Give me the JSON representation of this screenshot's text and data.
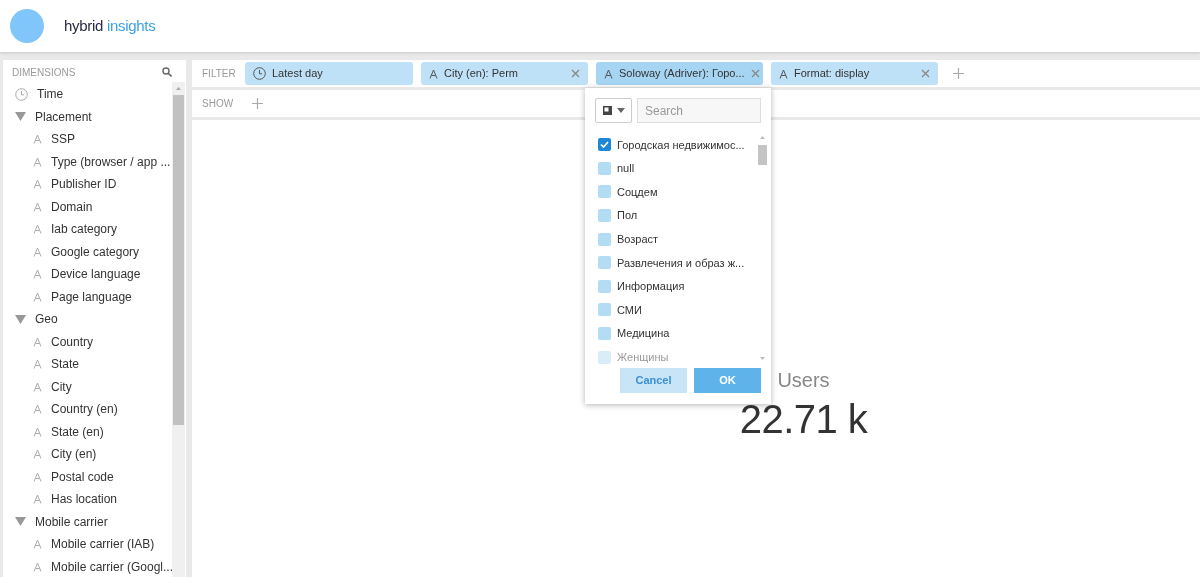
{
  "header": {
    "logo_text": {
      "dark": "hybrid",
      "light": "insights"
    }
  },
  "sidebar": {
    "title": "DIMENSIONS",
    "items": [
      {
        "kind": "time",
        "label": "Time"
      },
      {
        "kind": "group",
        "label": "Placement",
        "expanded": true,
        "children": [
          {
            "kind": "string",
            "label": "SSP"
          },
          {
            "kind": "string",
            "label": "Type (browser / app ..."
          },
          {
            "kind": "string",
            "label": "Publisher ID"
          },
          {
            "kind": "string",
            "label": "Domain"
          },
          {
            "kind": "string",
            "label": "Iab category"
          },
          {
            "kind": "string",
            "label": "Google category"
          },
          {
            "kind": "string",
            "label": "Device language"
          },
          {
            "kind": "string",
            "label": "Page language"
          }
        ]
      },
      {
        "kind": "group",
        "label": "Geo",
        "expanded": true,
        "children": [
          {
            "kind": "string",
            "label": "Country"
          },
          {
            "kind": "string",
            "label": "State"
          },
          {
            "kind": "string",
            "label": "City"
          },
          {
            "kind": "string",
            "label": "Country (en)"
          },
          {
            "kind": "string",
            "label": "State (en)"
          },
          {
            "kind": "string",
            "label": "City (en)"
          },
          {
            "kind": "string",
            "label": "Postal code"
          },
          {
            "kind": "string",
            "label": "Has location"
          }
        ]
      },
      {
        "kind": "group",
        "label": "Mobile carrier",
        "expanded": true,
        "children": [
          {
            "kind": "string",
            "label": "Mobile carrier (IAB)"
          },
          {
            "kind": "string",
            "label": "Mobile carrier (Googl..."
          }
        ]
      }
    ]
  },
  "filter": {
    "label": "FILTER",
    "chips": [
      {
        "kind": "time",
        "label": "Latest day",
        "removable": false,
        "selected": false
      },
      {
        "kind": "string",
        "label": "City (en): Perm",
        "removable": true,
        "selected": false
      },
      {
        "kind": "string",
        "label": "Soloway (Adriver): Горо...",
        "removable": true,
        "selected": true
      },
      {
        "kind": "string",
        "label": "Format: display",
        "removable": true,
        "selected": false
      }
    ]
  },
  "show": {
    "label": "SHOW"
  },
  "popup": {
    "search": {
      "placeholder": "Search"
    },
    "options": [
      {
        "label": "Городская недвижимос...",
        "checked": true
      },
      {
        "label": "null",
        "checked": false
      },
      {
        "label": "Соцдем",
        "checked": false
      },
      {
        "label": "Пол",
        "checked": false
      },
      {
        "label": "Возраст",
        "checked": false
      },
      {
        "label": "Развлечения и образ ж...",
        "checked": false
      },
      {
        "label": "Информация",
        "checked": false
      },
      {
        "label": "СМИ",
        "checked": false
      },
      {
        "label": "Медицина",
        "checked": false
      },
      {
        "label": "Женщины",
        "checked": false
      }
    ],
    "buttons": [
      {
        "kind": "cancel",
        "label": "Cancel"
      },
      {
        "kind": "ok",
        "label": "OK"
      }
    ]
  },
  "metric": {
    "label": "Users",
    "value": "22.71 k"
  }
}
